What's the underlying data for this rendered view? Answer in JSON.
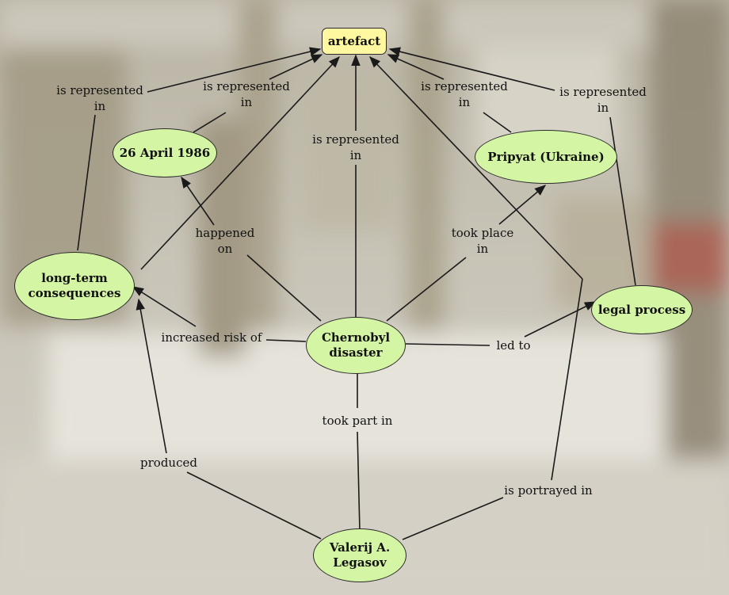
{
  "nodes": {
    "artefact": "artefact",
    "date": "26 April 1986",
    "pripyat": "Pripyat (Ukraine)",
    "consequences": "long-term\nconsequences",
    "legal": "legal process",
    "chernobyl": "Chernobyl\ndisaster",
    "legasov": "Valerij A.\nLegasov"
  },
  "labels": {
    "rep1": "is represented\nin",
    "rep2": "is represented\nin",
    "rep3": "is represented\nin",
    "rep4": "is represented\nin",
    "rep5": "is represented\nin",
    "happened": "happened\non",
    "tookplace": "took place\nin",
    "increased": "increased risk of",
    "ledto": "led to",
    "tookpart": "took part in",
    "produced": "produced",
    "portrayed": "is portrayed in"
  },
  "colors": {
    "concept_fill": "#d4f5a4",
    "root_fill": "#fff8a0",
    "line": "#1a1a1a"
  }
}
